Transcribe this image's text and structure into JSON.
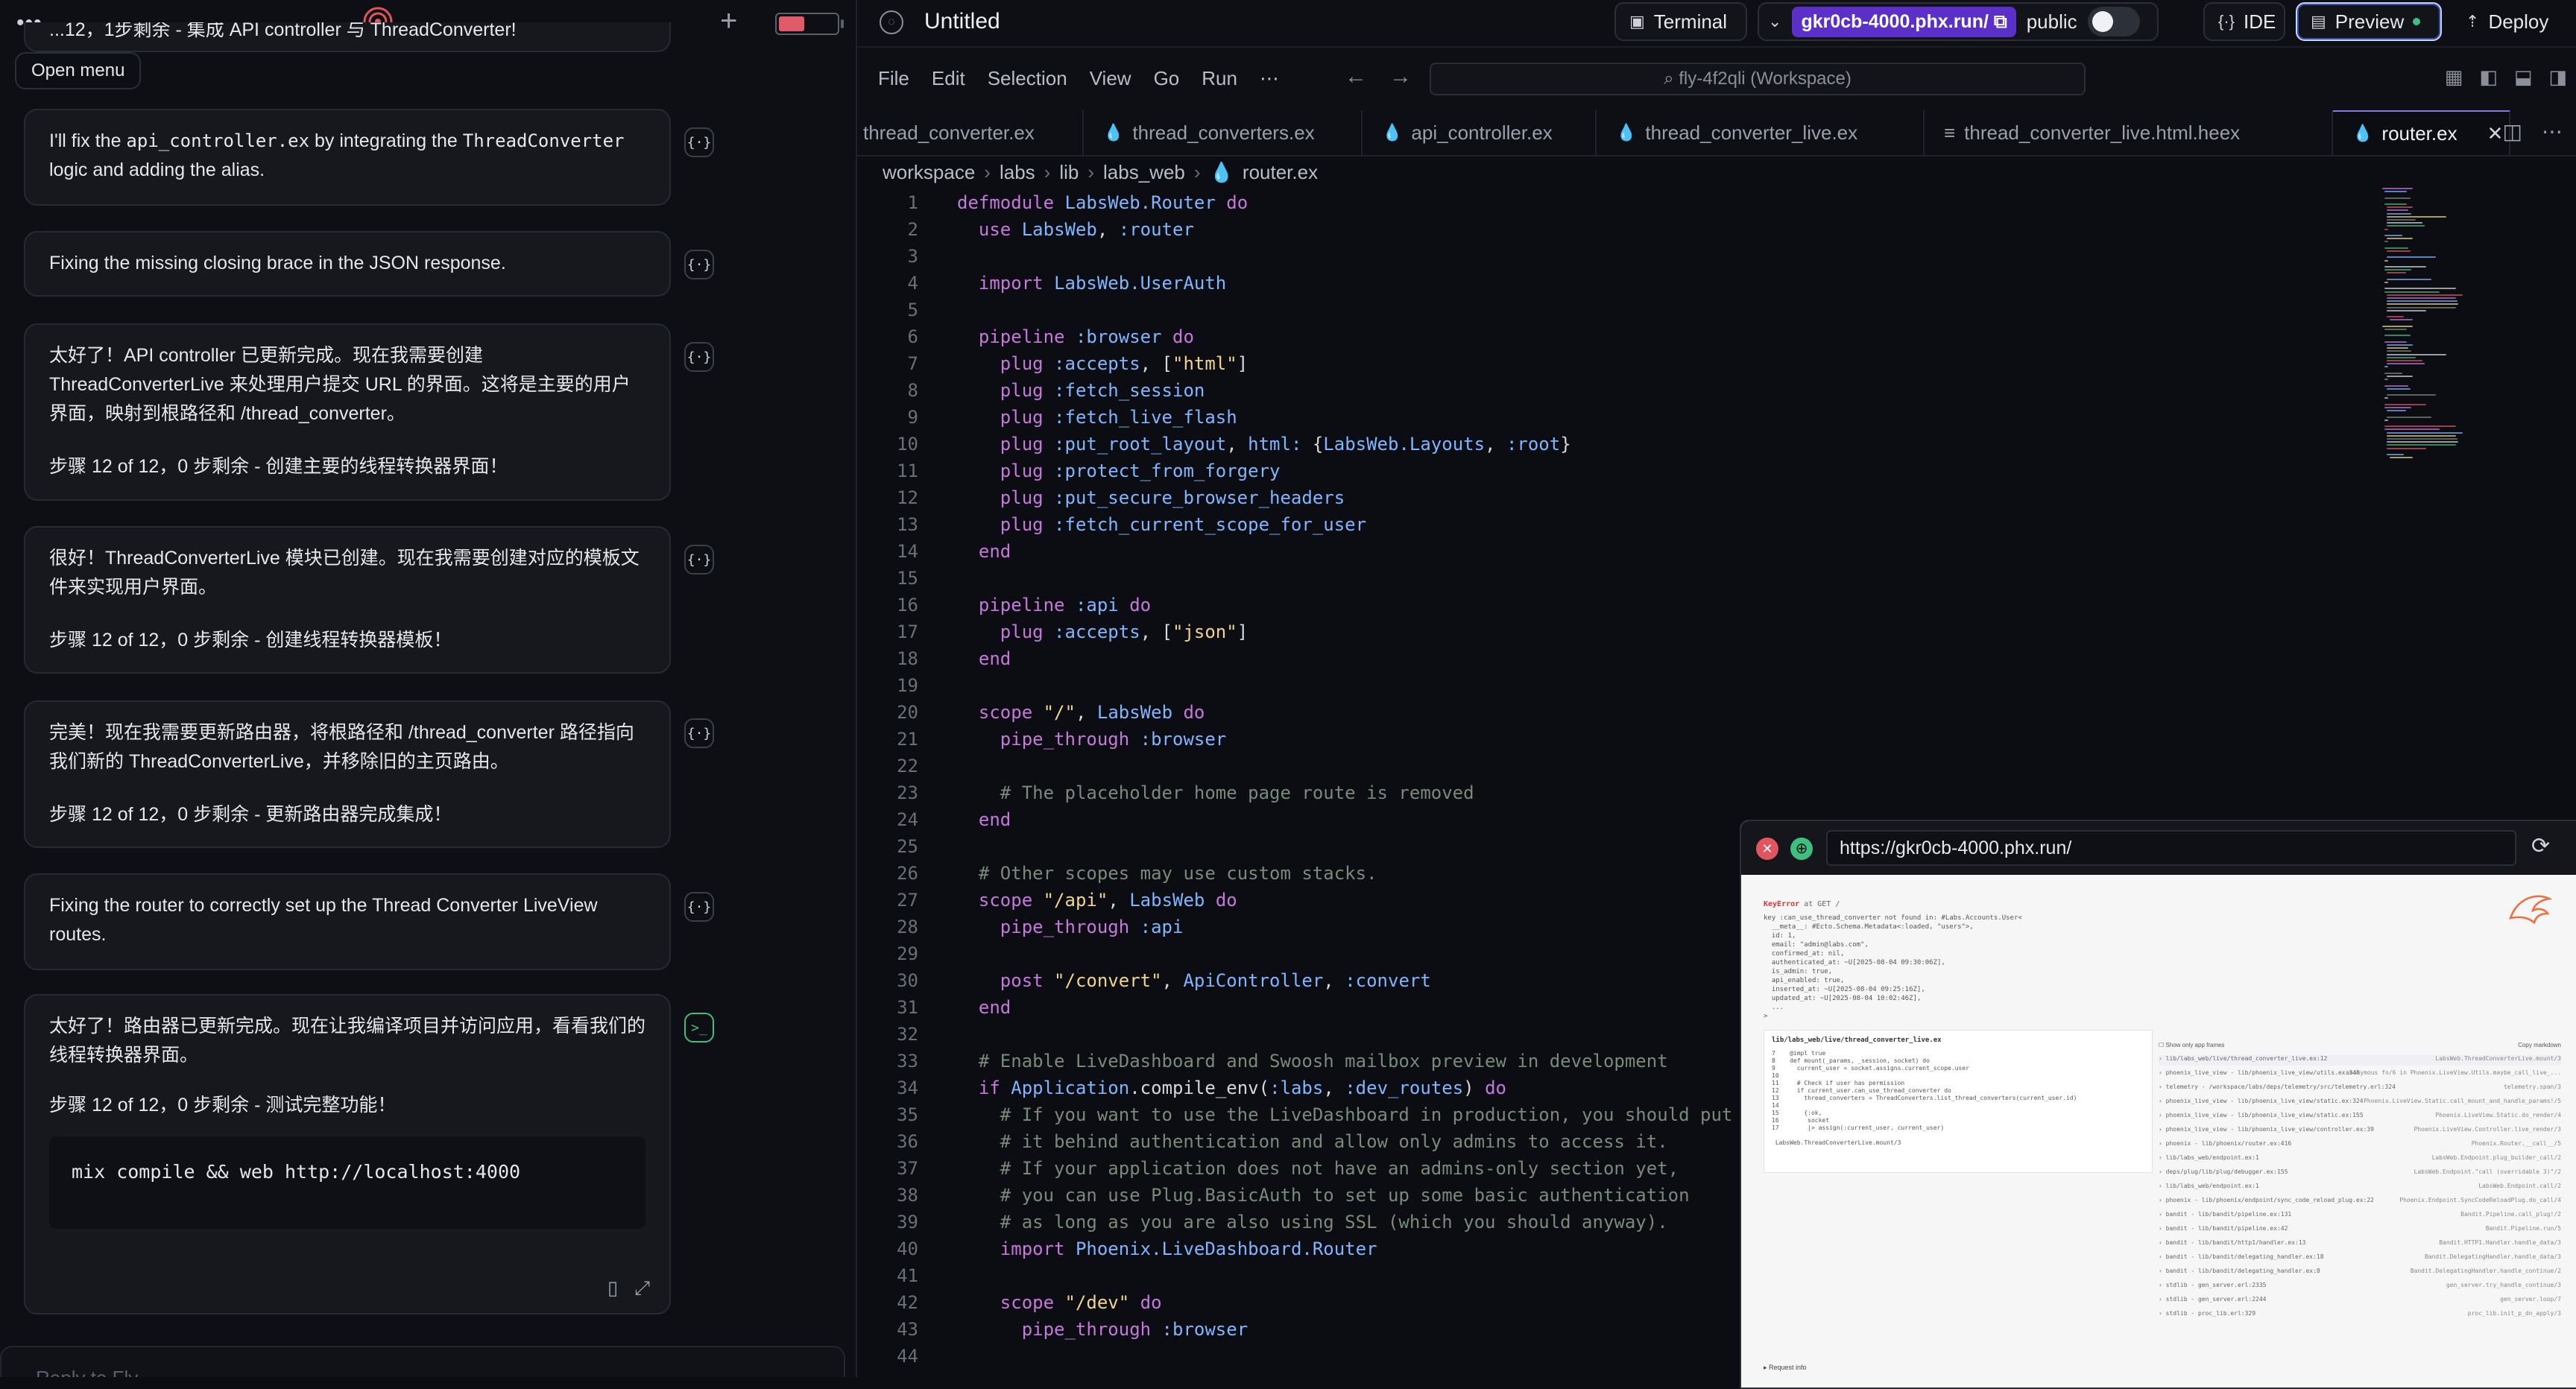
{
  "chat": {
    "open_menu_tooltip": "Open menu",
    "partial_top": "...12，1步剩余 - 集成 API controller 与 ThreadConverter!",
    "messages": [
      {
        "parts": [
          "I'll fix the ",
          "api_controller.ex",
          " by integrating the ",
          "ThreadConverter",
          " logic and adding the alias."
        ]
      },
      {
        "text": "Fixing the missing closing brace in the JSON response."
      },
      {
        "p1": "太好了！API controller 已更新完成。现在我需要创建 ThreadConverterLive 来处理用户提交 URL 的界面。这将是主要的用户界面，映射到根路径和 /thread_converter。",
        "p2": "步骤 12 of 12，0 步剩余 - 创建主要的线程转换器界面！"
      },
      {
        "p1": "很好！ThreadConverterLive 模块已创建。现在我需要创建对应的模板文件来实现用户界面。",
        "p2": "步骤 12 of 12，0 步剩余 - 创建线程转换器模板！"
      },
      {
        "p1": "完美！现在我需要更新路由器，将根路径和 /thread_converter 路径指向我们新的 ThreadConverterLive，并移除旧的主页路由。",
        "p2": "步骤 12 of 12，0 步剩余 - 更新路由器完成集成！"
      },
      {
        "text": "Fixing the router to correctly set up the Thread Converter LiveView routes."
      },
      {
        "p1": "太好了！路由器已更新完成。现在让我编译项目并访问应用，看看我们的线程转换器界面。",
        "p2": "步骤 12 of 12，0 步剩余 - 测试完整功能！",
        "code": "mix compile && web http://localhost:4000"
      }
    ],
    "reply_placeholder": "Reply to Fly..."
  },
  "topbar": {
    "title": "Untitled",
    "terminal_label": "Terminal",
    "url_label": "gkr0cb-4000.phx.run/",
    "visibility_label": "public",
    "ide_label": "IDE",
    "preview_label": "Preview",
    "deploy_label": "Deploy"
  },
  "ide": {
    "menu": [
      "File",
      "Edit",
      "Selection",
      "View",
      "Go",
      "Run",
      "⋯"
    ],
    "search_text": "fly-4f2qli (Workspace)",
    "tabs": [
      {
        "label": "thread_converter.ex",
        "icon": "none"
      },
      {
        "label": "thread_converters.ex",
        "icon": "elixir-drop-icon"
      },
      {
        "label": "api_controller.ex",
        "icon": "elixir-drop-icon"
      },
      {
        "label": "thread_converter_live.ex",
        "icon": "elixir-drop-icon"
      },
      {
        "label": "thread_converter_live.html.heex",
        "icon": "lines-icon"
      },
      {
        "label": "router.ex",
        "icon": "elixir-drop-icon",
        "active": true
      }
    ],
    "breadcrumb": [
      "workspace",
      "labs",
      "lib",
      "labs_web",
      "router.ex"
    ],
    "code_lines": [
      "defmodule LabsWeb.Router do",
      "  use LabsWeb, :router",
      "",
      "  import LabsWeb.UserAuth",
      "",
      "  pipeline :browser do",
      "    plug :accepts, [\"html\"]",
      "    plug :fetch_session",
      "    plug :fetch_live_flash",
      "    plug :put_root_layout, html: {LabsWeb.Layouts, :root}",
      "    plug :protect_from_forgery",
      "    plug :put_secure_browser_headers",
      "    plug :fetch_current_scope_for_user",
      "  end",
      "",
      "  pipeline :api do",
      "    plug :accepts, [\"json\"]",
      "  end",
      "",
      "  scope \"/\", LabsWeb do",
      "    pipe_through :browser",
      "",
      "    # The placeholder home page route is removed",
      "  end",
      "",
      "  # Other scopes may use custom stacks.",
      "  scope \"/api\", LabsWeb do",
      "    pipe_through :api",
      "",
      "    post \"/convert\", ApiController, :convert",
      "  end",
      "",
      "  # Enable LiveDashboard and Swoosh mailbox preview in development",
      "  if Application.compile_env(:labs, :dev_routes) do",
      "    # If you want to use the LiveDashboard in production, you should put",
      "    # it behind authentication and allow only admins to access it.",
      "    # If your application does not have an admins-only section yet,",
      "    # you can use Plug.BasicAuth to set up some basic authentication",
      "    # as long as you are also using SSL (which you should anyway).",
      "    import Phoenix.LiveDashboard.Router",
      "",
      "    scope \"/dev\" do",
      "      pipe_through :browser",
      ""
    ]
  },
  "preview": {
    "url": "https://gkr0cb-4000.phx.run/",
    "error_title": "KeyError",
    "error_route": "at GET /",
    "error_message": "key :can_use_thread_converter not found in: #Labs.Accounts.User<\n  __meta__: #Ecto.Schema.Metadata<:loaded, \"users\">,\n  id: 1,\n  email: \"admin@labs.com\",\n  confirmed_at: nil,\n  authenticated_at: ~U[2025-08-04 09:30:06Z],\n  is_admin: true,\n  api_enabled: true,\n  inserted_at: ~U[2025-08-04 09:25:16Z],\n  updated_at: ~U[2025-08-04 10:02:46Z],\n  ...\n>",
    "source_file": "lib/labs_web/live/thread_converter_live.ex",
    "source_code": "7    @impl true\n8    def mount(_params, _session, socket) do\n9      current_user = socket.assigns.current_scope.user\n10\n11     # Check if user has permission\n12     if current_user.can_use_thread_converter do\n13       thread_converters = ThreadConverters.list_thread_converters(current_user.id)\n14\n15       {:ok,\n16        socket\n17        |> assign(:current_user, current_user)\n\n LabsWeb.ThreadConverterLive.mount/3",
    "stack_header_left": "Show only app frames",
    "stack_header_right": "Copy markdown",
    "stack": [
      [
        "lib/labs_web/live/thread_converter_live.ex:12",
        "LabsWeb.ThreadConverterLive.mount/3"
      ],
      [
        "phoenix_live_view - lib/phoenix_live_view/utils.ex:348",
        "anonymous fn/6 in Phoenix.LiveView.Utils.maybe_call_live_..."
      ],
      [
        "telemetry - /workspace/labs/deps/telemetry/src/telemetry.erl:324",
        "telemetry.span/3"
      ],
      [
        "phoenix_live_view - lib/phoenix_live_view/static.ex:324",
        "Phoenix.LiveView.Static.call_mount_and_handle_params!/5"
      ],
      [
        "phoenix_live_view - lib/phoenix_live_view/static.ex:155",
        "Phoenix.LiveView.Static.do_render/4"
      ],
      [
        "phoenix_live_view - lib/phoenix_live_view/controller.ex:39",
        "Phoenix.LiveView.Controller.live_render/3"
      ],
      [
        "phoenix - lib/phoenix/router.ex:416",
        "Phoenix.Router.__call__/5"
      ],
      [
        "lib/labs_web/endpoint.ex:1",
        "LabsWeb.Endpoint.plug_builder_call/2"
      ],
      [
        "deps/plug/lib/plug/debugger.ex:155",
        "LabsWeb.Endpoint.\"call (overridable 3)\"/2"
      ],
      [
        "lib/labs_web/endpoint.ex:1",
        "LabsWeb.Endpoint.call/2"
      ],
      [
        "phoenix - lib/phoenix/endpoint/sync_code_reload_plug.ex:22",
        "Phoenix.Endpoint.SyncCodeReloadPlug.do_call/4"
      ],
      [
        "bandit - lib/bandit/pipeline.ex:131",
        "Bandit.Pipeline.call_plug!/2"
      ],
      [
        "bandit - lib/bandit/pipeline.ex:42",
        "Bandit.Pipeline.run/5"
      ],
      [
        "bandit - lib/bandit/http1/handler.ex:13",
        "Bandit.HTTP1.Handler.handle_data/3"
      ],
      [
        "bandit - lib/bandit/delegating_handler.ex:18",
        "Bandit.DelegatingHandler.handle_data/3"
      ],
      [
        "bandit - lib/bandit/delegating_handler.ex:8",
        "Bandit.DelegatingHandler.handle_continue/2"
      ],
      [
        "stdlib - gen_server.erl:2335",
        "gen_server.try_handle_continue/3"
      ],
      [
        "stdlib - gen_server.erl:2244",
        "gen_server.loop/7"
      ],
      [
        "stdlib - proc_lib.erl:329",
        "proc_lib.init_p_do_apply/3"
      ]
    ],
    "request_info": "▸ Request info"
  },
  "colors": {
    "accent": "#8b72e6",
    "url_pill": "#5b30c9",
    "ok": "#3fbf7f",
    "error": "#e0555e"
  }
}
